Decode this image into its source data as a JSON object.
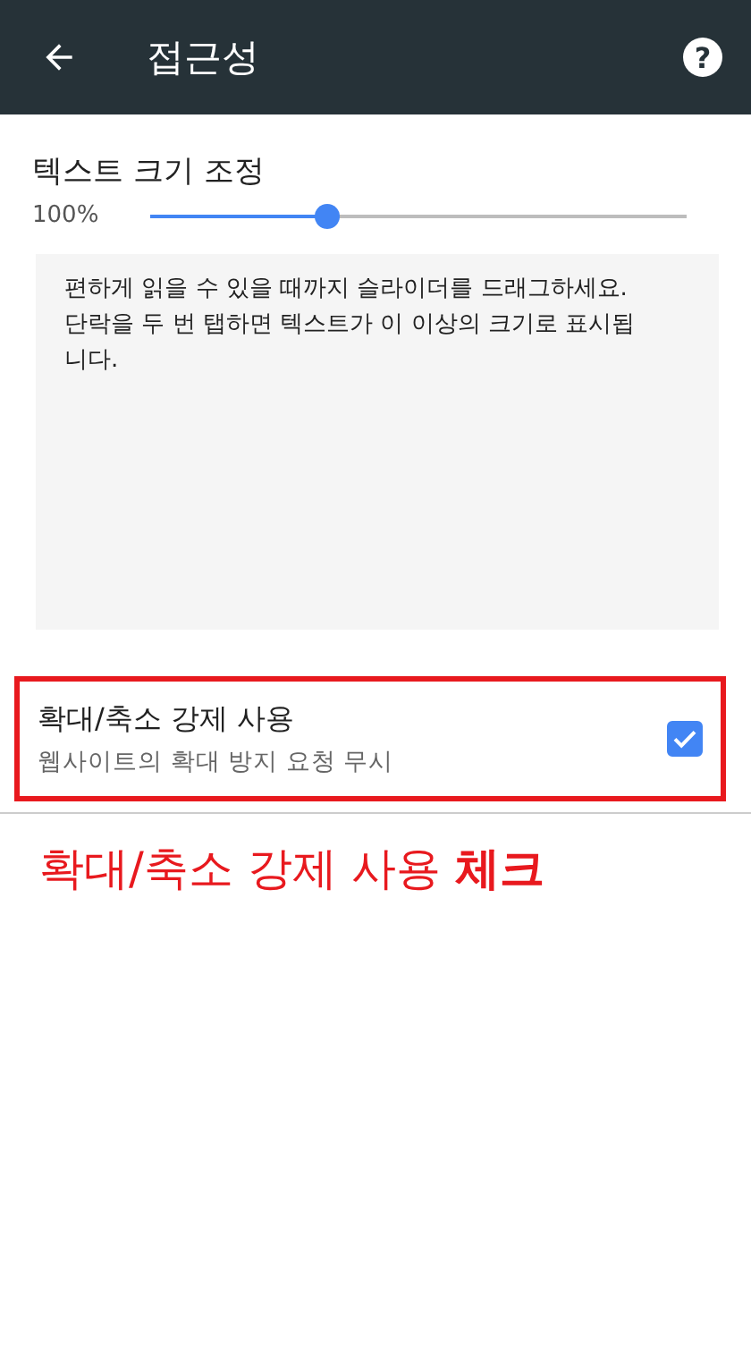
{
  "app_bar": {
    "title": "접근성",
    "help": "?"
  },
  "text_scale": {
    "title": "텍스트 크기 조정",
    "reading": "100%",
    "level": 0.33
  },
  "preview": {
    "text": "편하게 읽을 수 있을 때까지 슬라이더를 드래그하세요. 단락을 두 번 탭하면 텍스트가 이 이상의 크기로 표시됩니다."
  },
  "force_zoom": {
    "title": "확대/축소 강제 사용",
    "subtitle": "웹사이트의 확대 방지 요청 무시",
    "checked": true,
    "highlighted": true
  },
  "annotation": {
    "text": "확대/축소 강제 사용 **체크**"
  }
}
